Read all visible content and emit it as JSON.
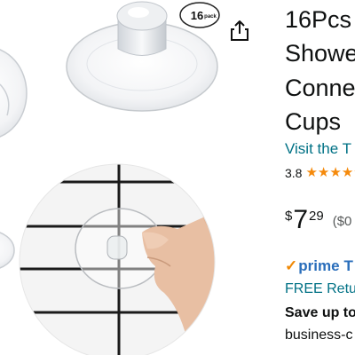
{
  "product": {
    "title_lines": [
      "16Pcs",
      "Showe",
      "Conne",
      "Cups"
    ],
    "store_link": "Visit the T",
    "rating": {
      "value": "3.8",
      "stars_filled": 4,
      "stars_shown": 5
    },
    "price": {
      "symbol": "$",
      "whole": "7",
      "fraction": "29",
      "unit_price": "($0"
    },
    "prime": {
      "check": "✓",
      "word": "prime",
      "extra": "T"
    },
    "returns_link": "FREE Retu",
    "save_text": "Save up to",
    "business_text": "business-c"
  },
  "image": {
    "badge_text": "16",
    "badge_sub": "pack"
  },
  "icons": {
    "share": "share-icon",
    "star": "star-icon"
  },
  "colors": {
    "link": "#007185",
    "star": "#f58a0c",
    "prime_blue": "#2a6ebb",
    "prime_orange": "#f08804"
  }
}
